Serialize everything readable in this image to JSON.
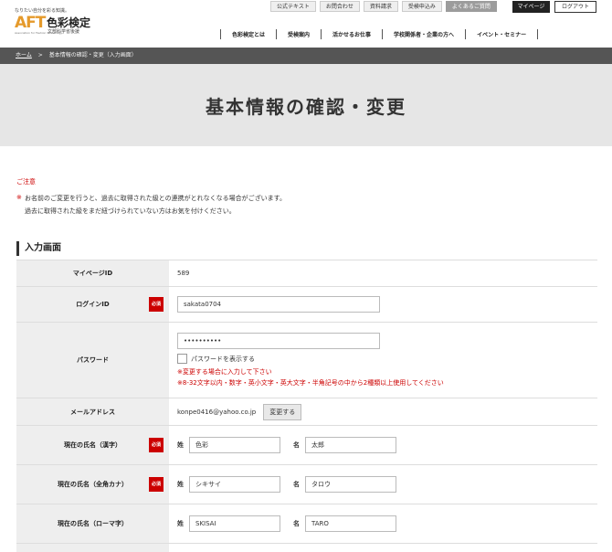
{
  "header": {
    "logo_tagline": "なりたい自分を彩る知識。",
    "logo_mark": "AFT",
    "logo_sub": "Association for Fashion Technology",
    "logo_name": "色彩検定",
    "logo_org": "文部科学省後援",
    "top_links": [
      "公式テキスト",
      "お問合わせ",
      "資料請求",
      "受検申込み",
      "よくあるご質問"
    ],
    "mypage_label": "マイページ",
    "logout_label": "ログアウト",
    "nav": [
      "色彩検定とは",
      "受検案内",
      "活かせるお仕事",
      "学校関係者・企業の方へ",
      "イベント・セミナー"
    ]
  },
  "breadcrumb": {
    "home": "ホーム",
    "separator": ">",
    "current": "基本情報の確認・変更（入力画面）"
  },
  "page_title": "基本情報の確認・変更",
  "notice": {
    "title": "ご注意",
    "mark": "※",
    "line1": "お名前のご変更を行うと、過去に取得された級との連携がとれなくなる場合がございます。",
    "line2": "過去に取得された級をまだ紐づけられていない方はお気を付けください。"
  },
  "section_title": "入力画面",
  "required_label": "必須",
  "form": {
    "mypage_id": {
      "label": "マイページID",
      "value": "589"
    },
    "login_id": {
      "label": "ログインID",
      "value": "sakata0704"
    },
    "password": {
      "label": "パスワード",
      "value": "••••••••••",
      "show_label": "パスワードを表示する",
      "note1": "※変更する場合に入力して下さい",
      "note2": "※8-32文字以内・数字・英小文字・英大文字・半角記号の中から2種類以上使用してください"
    },
    "email": {
      "label": "メールアドレス",
      "value": "konpe0416@yahoo.co.jp",
      "button": "変更する"
    },
    "name_kanji": {
      "label": "現在の氏名（漢字）",
      "sei_label": "姓",
      "sei": "色彩",
      "mei_label": "名",
      "mei": "太郎"
    },
    "name_kana": {
      "label": "現在の氏名（全角カナ）",
      "sei_label": "姓",
      "sei": "シキサイ",
      "mei_label": "名",
      "mei": "タロウ"
    },
    "name_roman": {
      "label": "現在の氏名（ローマ字）",
      "sei_label": "姓",
      "sei": "SKISAI",
      "mei_label": "名",
      "mei": "TARO"
    }
  }
}
